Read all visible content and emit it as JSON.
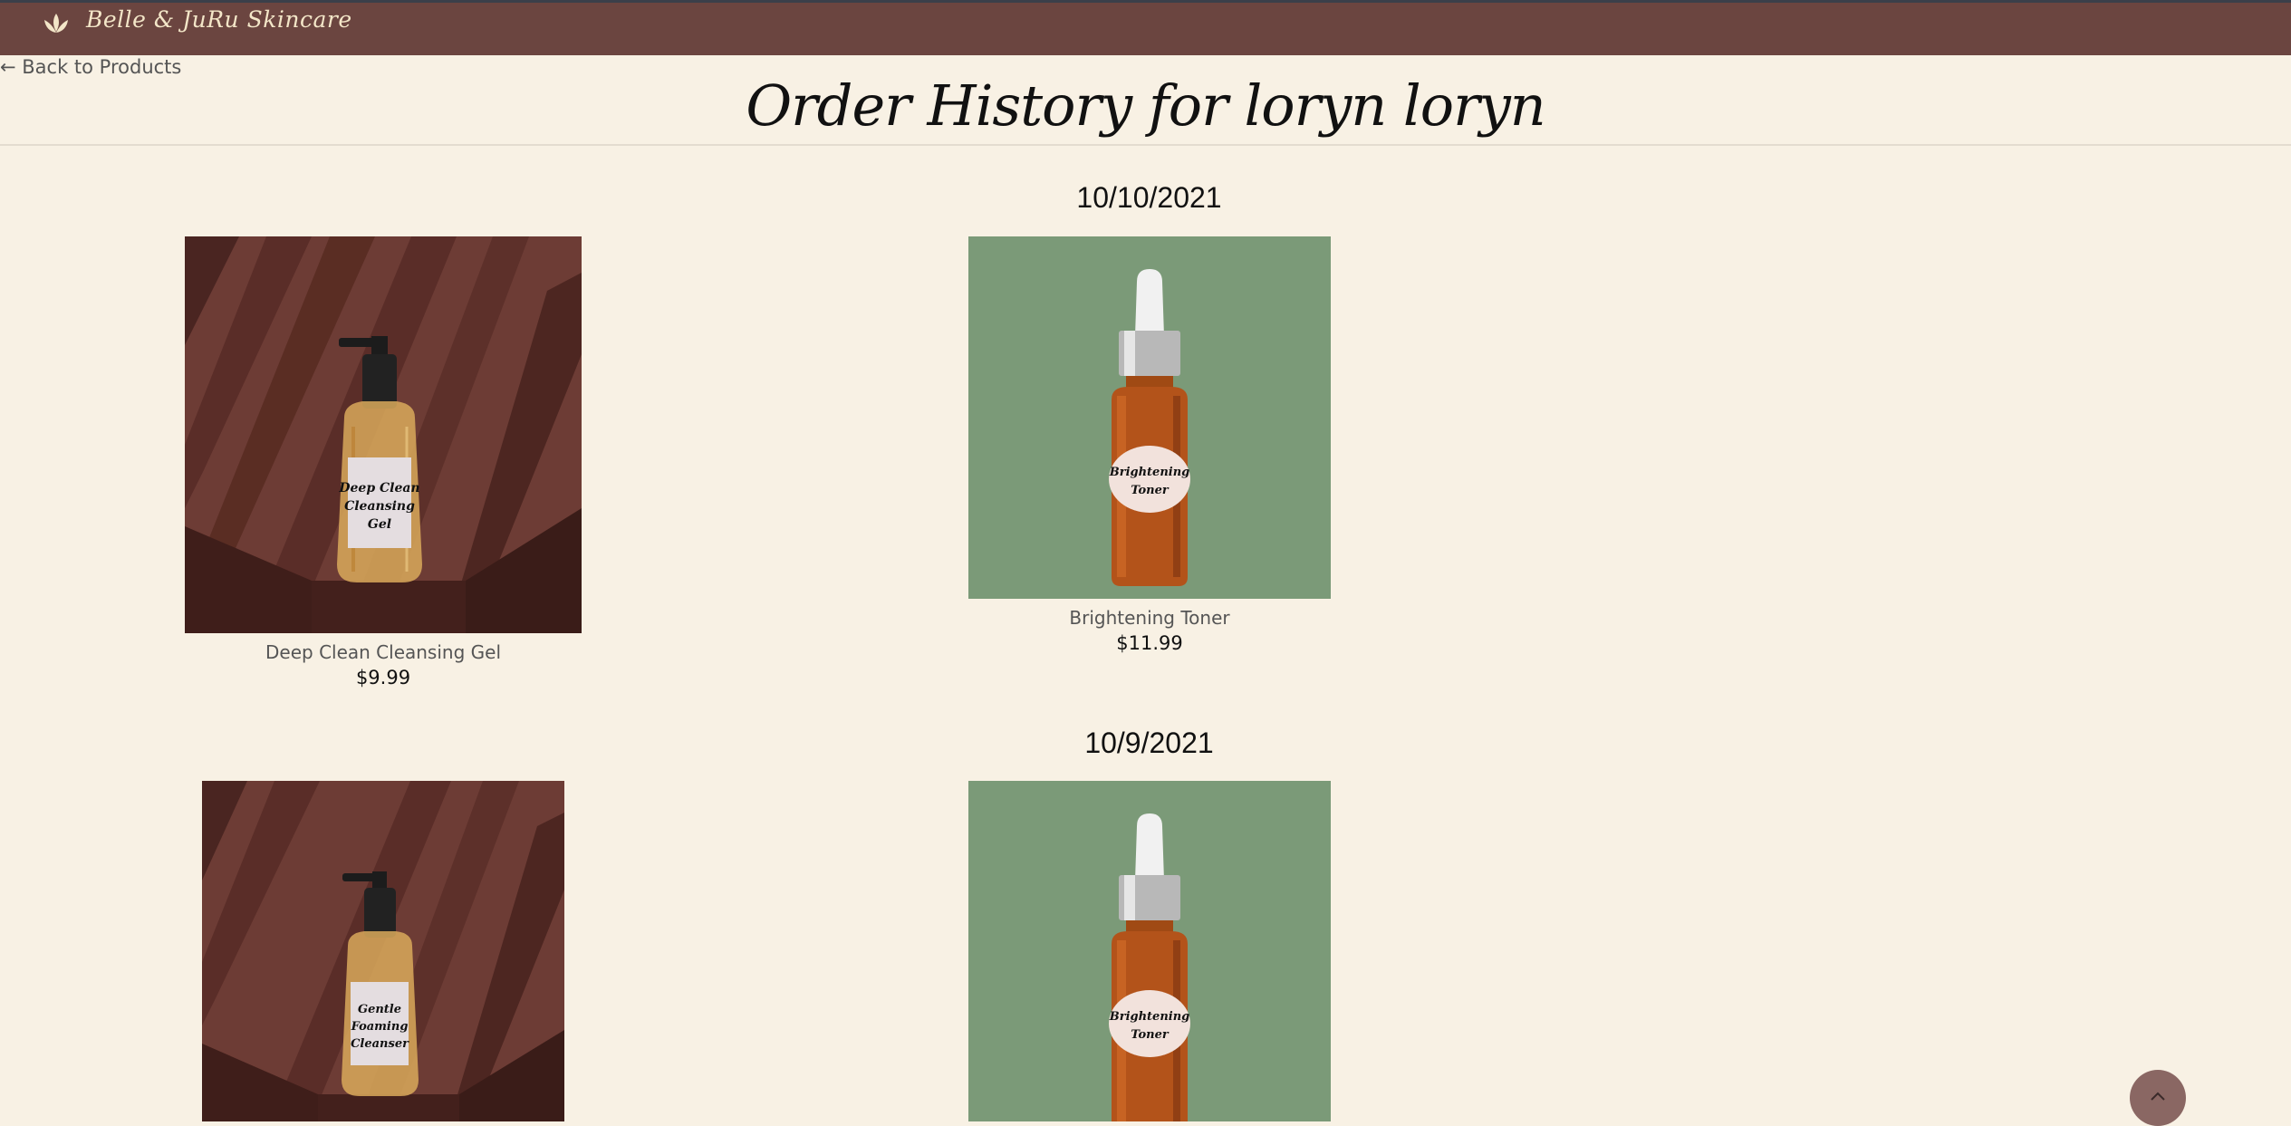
{
  "header": {
    "brand": "Belle & JuRu Skincare",
    "logo_icon": "lotus-icon"
  },
  "nav": {
    "back_label": "← Back to Products"
  },
  "page": {
    "title": "Order History for loryn loryn"
  },
  "orders": [
    {
      "date": "10/10/2021",
      "items": [
        {
          "name": "Deep Clean Cleansing Gel",
          "price": "$9.99",
          "bottle_label": [
            "Deep Clean",
            "Cleansing",
            "Gel"
          ]
        },
        {
          "name": "Brightening Toner",
          "price": "$11.99",
          "bottle_label": [
            "Brightening",
            "Toner"
          ]
        }
      ]
    },
    {
      "date": "10/9/2021",
      "items": [
        {
          "name": "Gentle Foaming Cleanser",
          "bottle_label": [
            "Gentle",
            "Foaming",
            "Cleanser"
          ]
        },
        {
          "name": "Brightening Toner",
          "bottle_label": [
            "Brightening",
            "Toner"
          ]
        }
      ]
    }
  ],
  "scroll_top": {
    "icon": "chevron-up-icon"
  },
  "colors": {
    "header_bg": "#6b4540",
    "page_bg": "#f8f1e4",
    "brand_text": "#f3e6c8",
    "toner_bg": "#7b9a78",
    "scroll_button": "#8a6763"
  }
}
